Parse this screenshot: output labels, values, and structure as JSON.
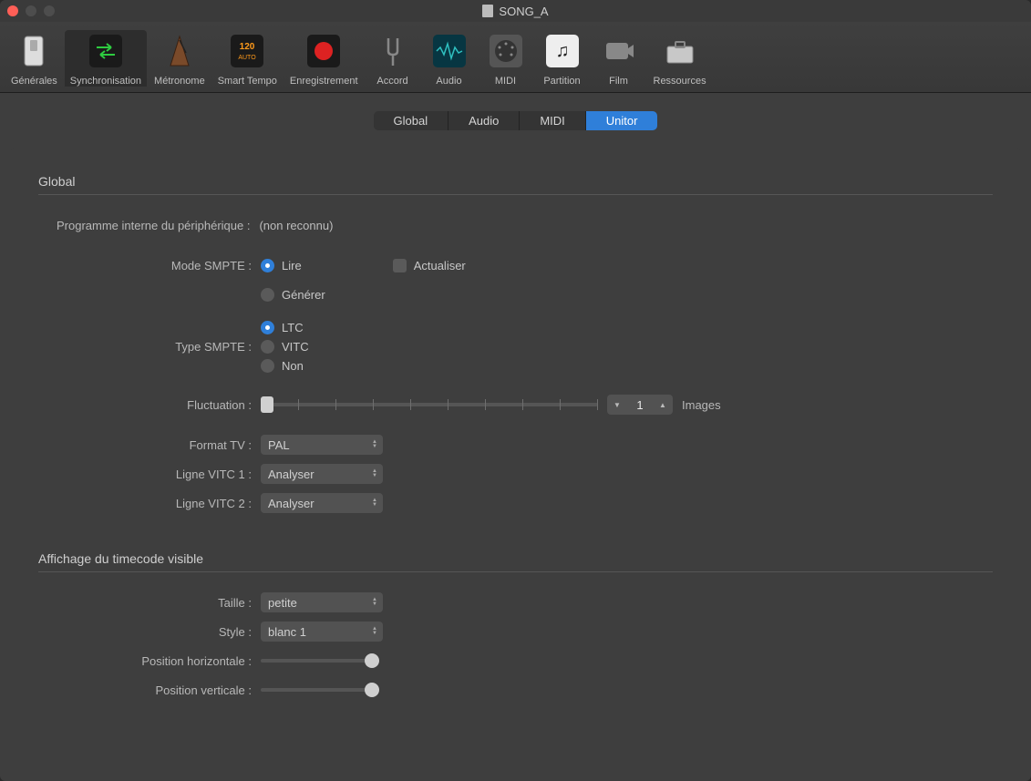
{
  "window": {
    "title": "SONG_A"
  },
  "toolbar": {
    "items": [
      {
        "label": "Générales"
      },
      {
        "label": "Synchronisation"
      },
      {
        "label": "Métronome"
      },
      {
        "label": "Smart Tempo"
      },
      {
        "label": "Enregistrement"
      },
      {
        "label": "Accord"
      },
      {
        "label": "Audio"
      },
      {
        "label": "MIDI"
      },
      {
        "label": "Partition"
      },
      {
        "label": "Film"
      },
      {
        "label": "Ressources"
      }
    ],
    "selected": "Synchronisation"
  },
  "sub_tabs": {
    "items": [
      "Global",
      "Audio",
      "MIDI",
      "Unitor"
    ],
    "active": "Unitor"
  },
  "sections": {
    "global": {
      "heading": "Global",
      "program_label": "Programme interne du périphérique :",
      "program_value": "(non reconnu)",
      "smpte_mode_label": "Mode SMPTE :",
      "smpte_mode_options": {
        "read": "Lire",
        "generate": "Générer"
      },
      "smpte_mode_selected": "Lire",
      "refresh_label": "Actualiser",
      "smpte_type_label": "Type SMPTE :",
      "smpte_type_options": {
        "ltc": "LTC",
        "vitc": "VITC",
        "none": "Non"
      },
      "smpte_type_selected": "LTC",
      "fluctuation_label": "Fluctuation :",
      "fluctuation_value": "1",
      "fluctuation_unit": "Images",
      "tv_format_label": "Format TV :",
      "tv_format_value": "PAL",
      "vitc1_label": "Ligne VITC 1 :",
      "vitc1_value": "Analyser",
      "vitc2_label": "Ligne VITC 2 :",
      "vitc2_value": "Analyser"
    },
    "timecode": {
      "heading": "Affichage du timecode visible",
      "size_label": "Taille :",
      "size_value": "petite",
      "style_label": "Style :",
      "style_value": "blanc 1",
      "hpos_label": "Position horizontale :",
      "vpos_label": "Position verticale :"
    }
  }
}
